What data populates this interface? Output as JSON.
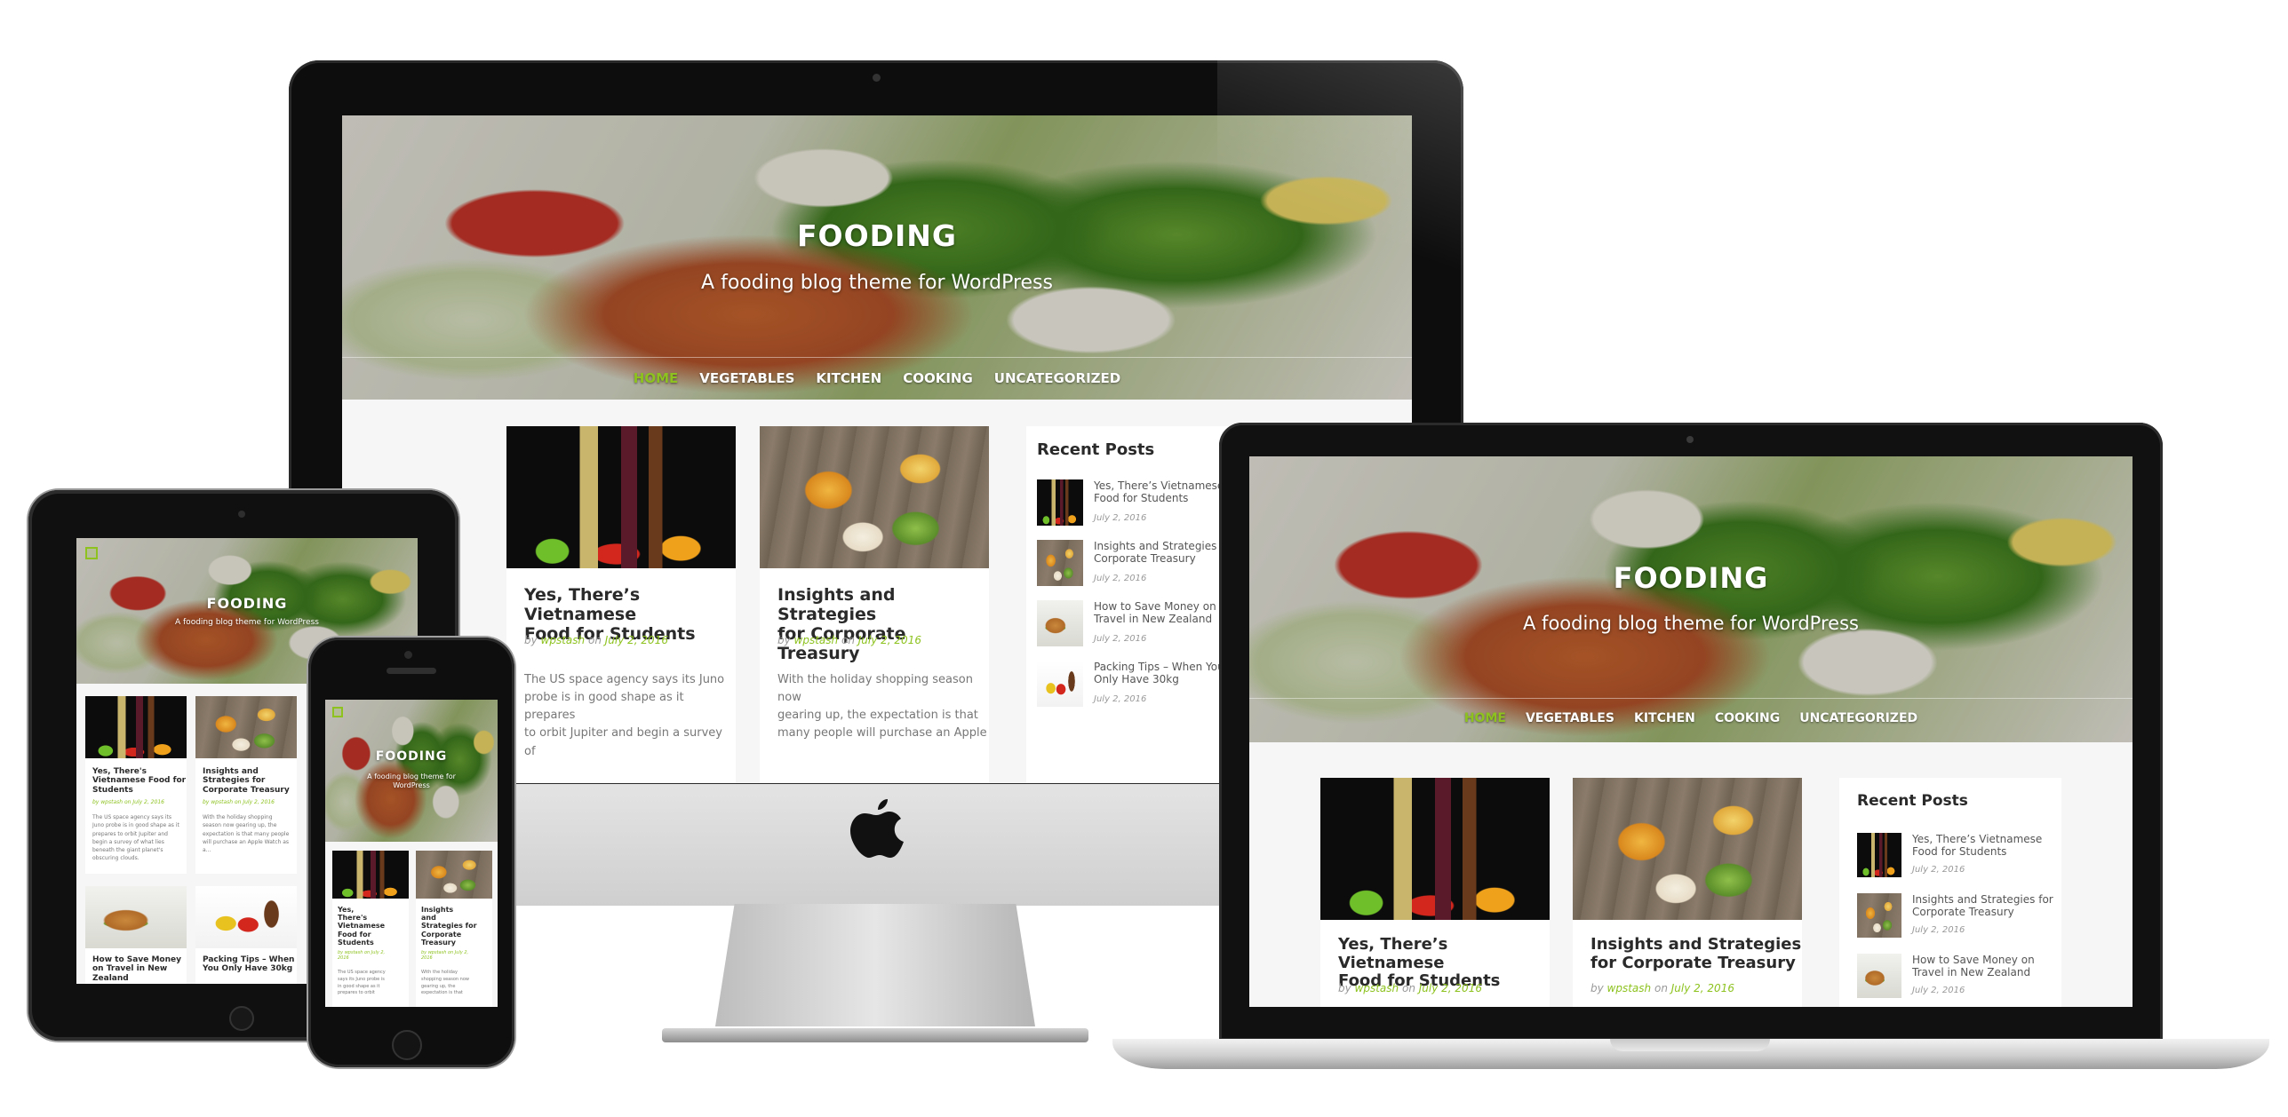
{
  "site": {
    "title": "FOODING",
    "tagline": "A fooding blog theme for WordPress"
  },
  "nav": {
    "items": [
      "HOME",
      "VEGETABLES",
      "KITCHEN",
      "COOKING",
      "UNCATEGORIZED"
    ],
    "active": "HOME"
  },
  "posts": [
    {
      "title": "Yes, There's Vietnamese Food for Students",
      "title_line1": "Yes, There’s Vietnamese",
      "title_line2": "Food for Students",
      "by": "by",
      "author": "wpstash",
      "on": "on",
      "date": "July 2, 2016",
      "excerpt_line1": "The US space agency says its Juno",
      "excerpt_line2": "probe is in good shape as it prepares",
      "excerpt_line3": "to orbit Jupiter and begin a survey of"
    },
    {
      "title": "Insights and Strategies for Corporate Treasury",
      "title_line1": "Insights and Strategies",
      "title_line2": "for Corporate Treasury",
      "by": "by",
      "author": "wpstash",
      "on": "on",
      "date": "July 2, 2016",
      "excerpt_line1": "With the holiday shopping season now",
      "excerpt_line2": "gearing up, the expectation is that",
      "excerpt_line3": "many people will purchase an Apple"
    }
  ],
  "recent_posts": {
    "heading": "Recent Posts",
    "items": [
      {
        "line1": "Yes, There’s Vietnamese",
        "line2": "Food for Students",
        "date": "July 2, 2016"
      },
      {
        "line1": "Insights and Strategies for",
        "line2": "Corporate Treasury",
        "date": "July 2, 2016"
      },
      {
        "line1": "How to Save Money on",
        "line2": "Travel in New Zealand",
        "date": "July 2, 2016"
      },
      {
        "line1": "Packing Tips – When You",
        "line2": "Only Have 30kg",
        "date": "July 2, 2016"
      }
    ]
  },
  "tablet": {
    "post1_l1": "Yes, There's",
    "post1_l2": "Vietnamese Food for",
    "post1_l3": "Students",
    "post2_l1": "Insights and",
    "post2_l2": "Strategies for",
    "post2_l3": "Corporate Treasury",
    "post3_l1": "How to Save Money",
    "post3_l2": "on Travel in New",
    "post3_l3": "Zealand",
    "post4_l1": "Packing Tips – When",
    "post4_l2": "You Only Have 30kg",
    "meta": "by wpstash on July 2, 2016",
    "ex1_l1": "The US space agency says its",
    "ex1_l2": "Juno probe is in good shape as it",
    "ex1_l3": "prepares to orbit Jupiter and",
    "ex1_l4": "begin a survey of what lies",
    "ex1_l5": "beneath the giant planet's",
    "ex1_l6": "obscuring clouds.",
    "ex2_l1": "With the holiday shopping",
    "ex2_l2": "season now gearing up, the",
    "ex2_l3": "expectation is that many people",
    "ex2_l4": "will purchase an Apple Watch as",
    "ex2_l5": "a..."
  },
  "phone": {
    "tagline_l1": "A fooding blog theme for",
    "tagline_l2": "WordPress",
    "post1_l1": "Yes,",
    "post1_l2": "There's",
    "post1_l3": "Vietnamese",
    "post1_l4": "Food for",
    "post1_l5": "Students",
    "post2_l1": "Insights",
    "post2_l2": "and",
    "post2_l3": "Strategies for",
    "post2_l4": "Corporate",
    "post2_l5": "Treasury",
    "meta_l1": "by wpstash on July 2,",
    "meta_l2": "2016",
    "ex1_l1": "The US space agency",
    "ex1_l2": "says its Juno probe is",
    "ex1_l3": "in good shape as it",
    "ex1_l4": "prepares to orbit",
    "ex2_l1": "With the holiday",
    "ex2_l2": "shopping season now",
    "ex2_l3": "gearing up, the",
    "ex2_l4": "expectation is that"
  },
  "colors": {
    "accent": "#8dc21f",
    "text": "#2a2a2a",
    "muted": "#999999",
    "bezel": "#0d0d0d"
  },
  "icons": {
    "brand": "apple-logo-icon"
  }
}
